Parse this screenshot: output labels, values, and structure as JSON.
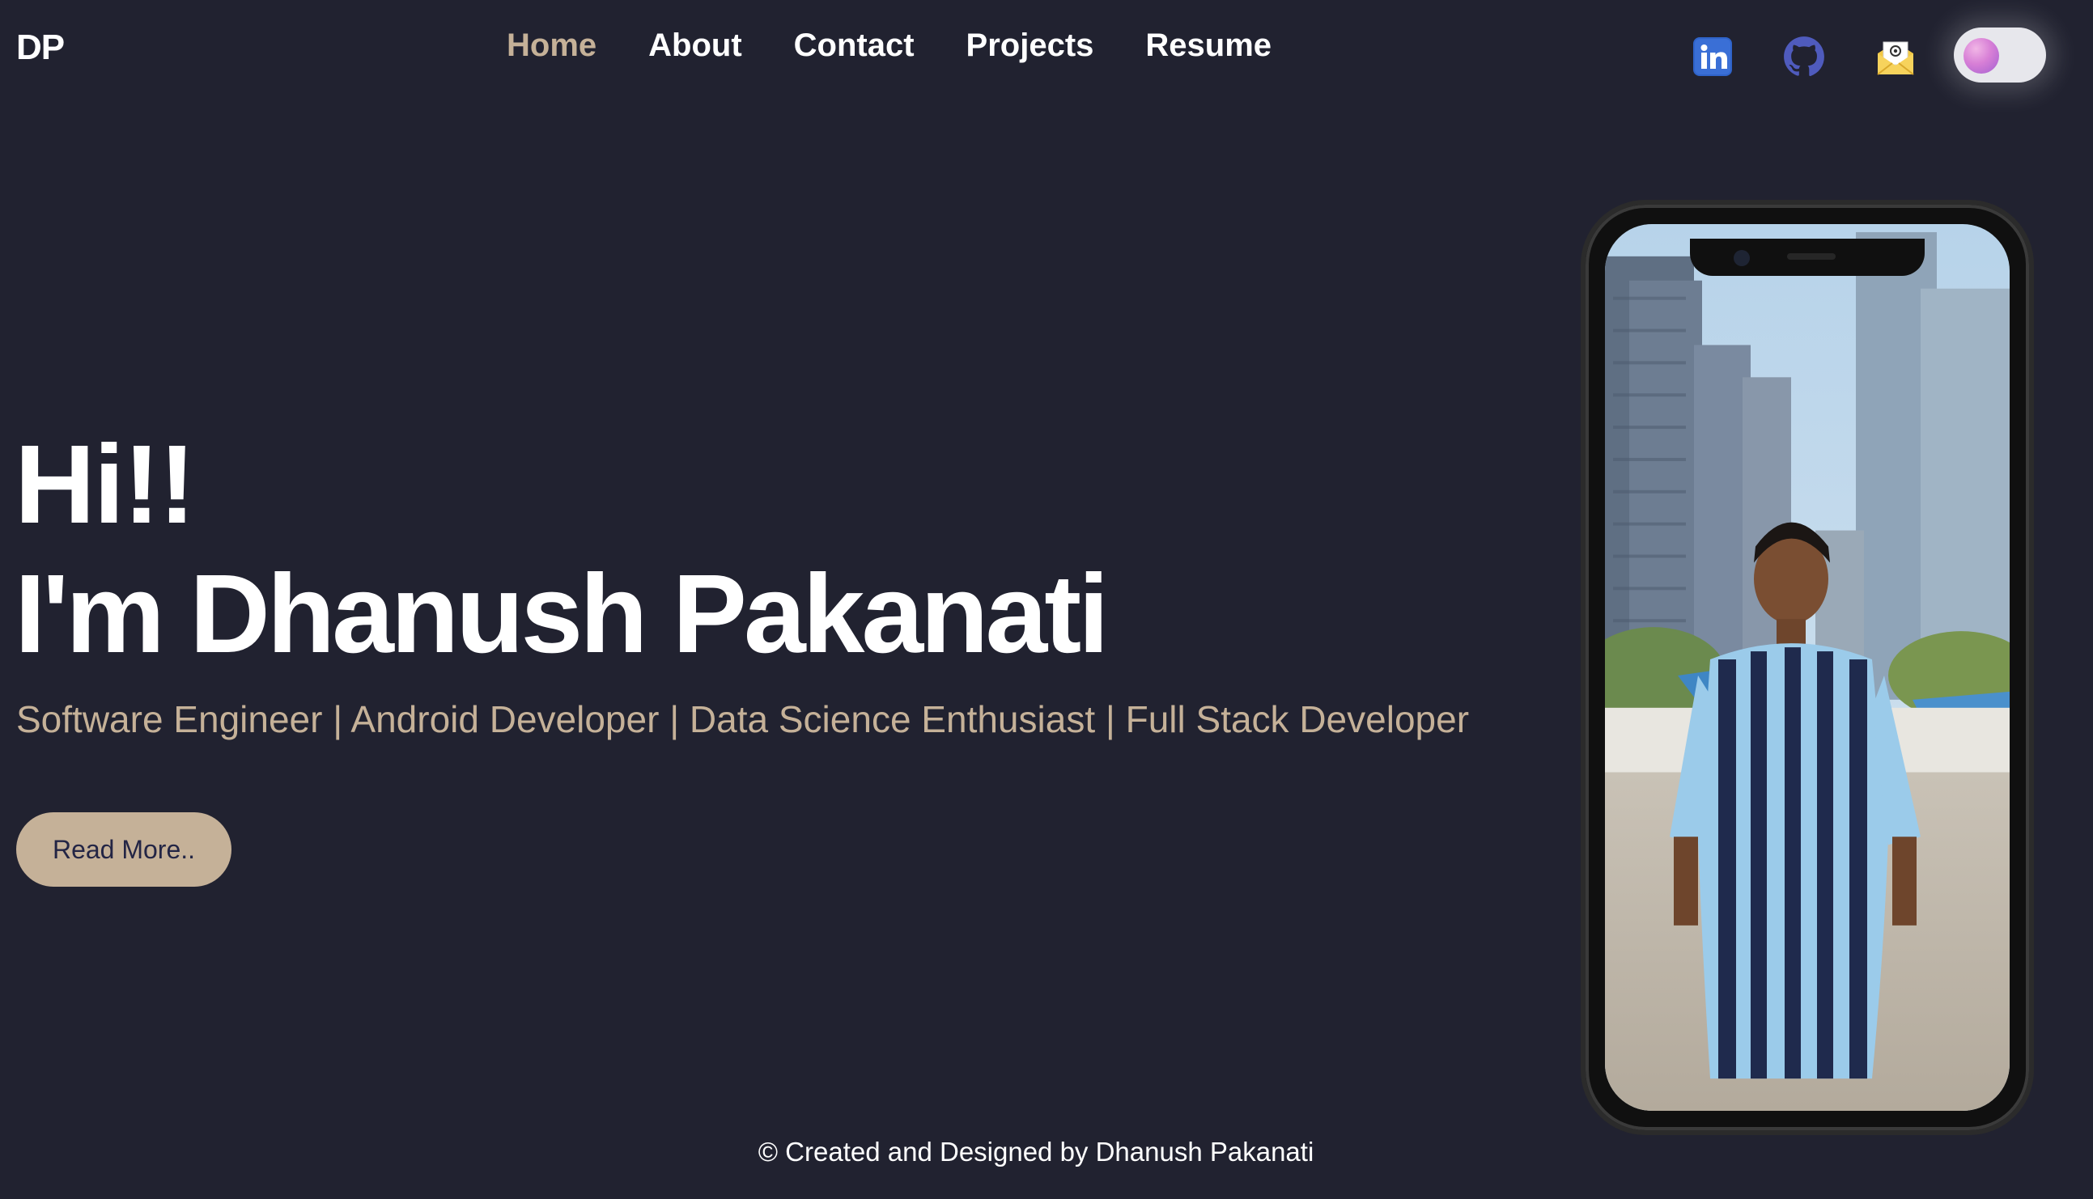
{
  "brand": {
    "logo": "DP"
  },
  "nav": {
    "items": [
      {
        "label": "Home",
        "active": true
      },
      {
        "label": "About",
        "active": false
      },
      {
        "label": "Contact",
        "active": false
      },
      {
        "label": "Projects",
        "active": false
      },
      {
        "label": "Resume",
        "active": false
      }
    ]
  },
  "social": {
    "icons": [
      "linkedin-icon",
      "github-icon",
      "mail-icon"
    ]
  },
  "theme_toggle": {
    "state": "dark"
  },
  "hero": {
    "greeting": "Hi!!",
    "name": "I'm Dhanush Pakanati",
    "tagline": "Software Engineer | Android Developer | Data Science Enthusiast | Full Stack Developer",
    "cta_label": "Read More.."
  },
  "footer": {
    "text": "© Created and Designed by Dhanush Pakanati"
  },
  "colors": {
    "background": "#212230",
    "accent": "#c5b198",
    "text": "#ffffff",
    "button_text": "#232545"
  }
}
